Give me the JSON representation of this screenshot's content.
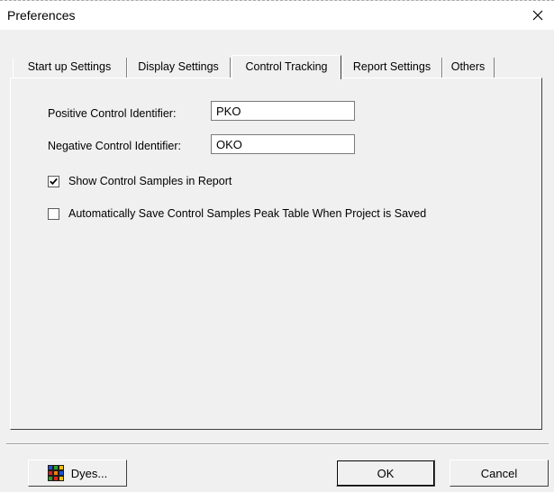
{
  "window": {
    "title": "Preferences",
    "close_glyph": "✕"
  },
  "tabs": [
    {
      "label": "Start up Settings",
      "active": false
    },
    {
      "label": "Display Settings",
      "active": false
    },
    {
      "label": "Control Tracking",
      "active": true
    },
    {
      "label": "Report Settings",
      "active": false
    },
    {
      "label": "Others",
      "active": false
    }
  ],
  "control_tracking": {
    "positive_label": "Positive Control Identifier:",
    "positive_value": "PKO",
    "negative_label": "Negative Control Identifier:",
    "negative_value": "OKO",
    "show_samples": {
      "label": "Show Control Samples in Report",
      "checked": true
    },
    "auto_save": {
      "label": "Automatically Save Control Samples Peak Table When Project is Saved",
      "checked": false
    }
  },
  "buttons": {
    "dyes": "Dyes...",
    "ok": "OK",
    "cancel": "Cancel"
  },
  "icons": {
    "close": "close-icon",
    "dyes": "dyes-grid-icon",
    "check": "checkmark-icon"
  }
}
